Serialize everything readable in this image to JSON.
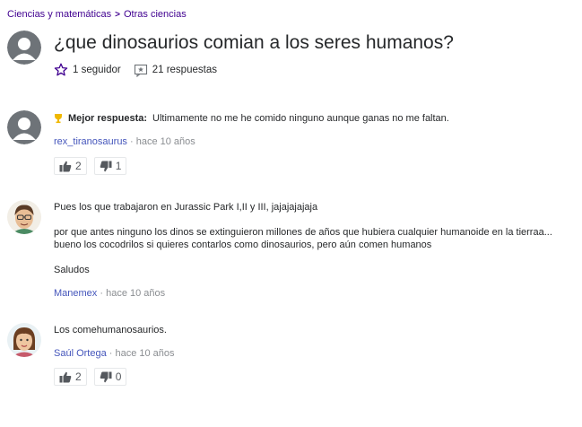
{
  "breadcrumb": {
    "category": "Ciencias y matemáticas",
    "separator": ">",
    "subcategory": "Otras ciencias"
  },
  "question": {
    "title": "¿que dinosaurios comian a los seres humanos?",
    "followers": "1 seguidor",
    "answers": "21 respuestas",
    "avatar_icon": "default-user-icon"
  },
  "answers": [
    {
      "best_label": "Mejor respuesta:",
      "text": "Ultimamente no me he comido ninguno aunque ganas no me faltan.",
      "user": "rex_tiranosaurus",
      "time": "· hace 10 años",
      "upvotes": "2",
      "downvotes": "1",
      "avatar_icon": "default-user-icon"
    },
    {
      "lines": [
        "Pues los que trabajaron en Jurassic Park I,II y III, jajajajajaja",
        "por que antes ninguno los dinos se extinguieron millones de años que hubiera cualquier humanoide en la tierraa...",
        "bueno los cocodrilos si quieres contarlos como dinosaurios, pero aún comen humanos",
        "Saludos"
      ],
      "user": "Manemex",
      "time": "· hace 10 años",
      "avatar_icon": "cartoon-man-avatar"
    },
    {
      "text": "Los comehumanosaurios.",
      "user": "Saúl Ortega",
      "time": "· hace 10 años",
      "upvotes": "2",
      "downvotes": "0",
      "avatar_icon": "cartoon-woman-avatar"
    }
  ],
  "colors": {
    "link_purple": "#400090",
    "user_link": "#4455bb",
    "muted": "#8a8d91",
    "best_icon": "#f0b800"
  }
}
